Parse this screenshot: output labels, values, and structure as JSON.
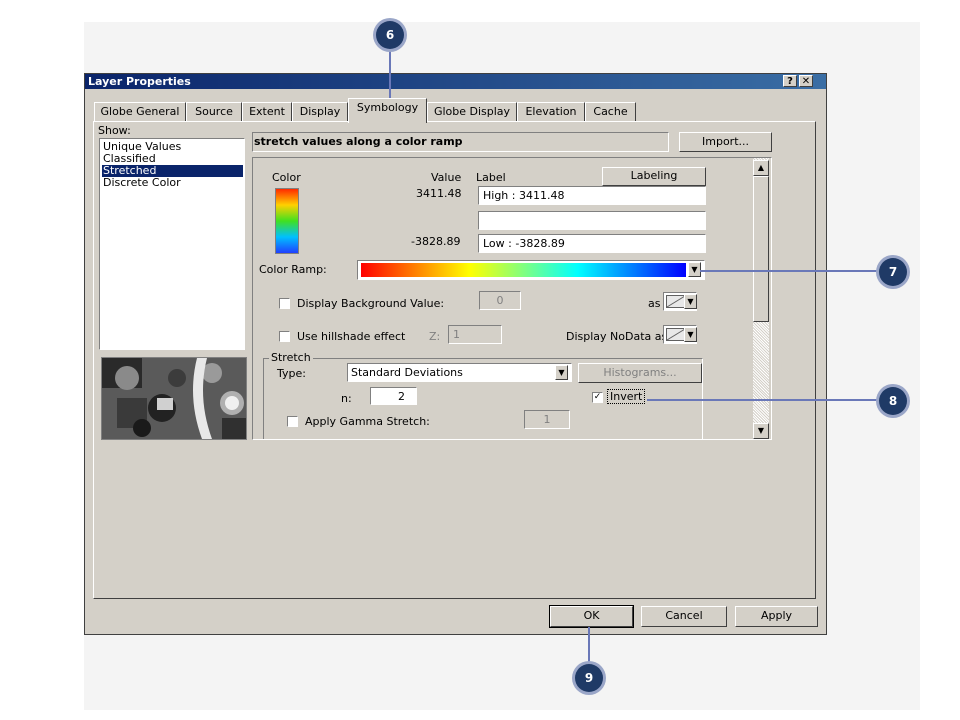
{
  "window": {
    "title": "Layer Properties",
    "help_btn": "?",
    "close_btn": "✕"
  },
  "tabs": [
    "Globe General",
    "Source",
    "Extent",
    "Display",
    "Symbology",
    "Globe Display",
    "Elevation",
    "Cache"
  ],
  "active_tab": "Symbology",
  "show": {
    "label": "Show:",
    "items": [
      "Unique Values",
      "Classified",
      "Stretched",
      "Discrete Color"
    ],
    "selected": "Stretched"
  },
  "header": {
    "description": "stretch values along a color ramp",
    "import_button": "Import..."
  },
  "legend": {
    "color_header": "Color",
    "value_header": "Value",
    "label_header": "Label",
    "labeling_button": "Labeling",
    "high_value": "3411.48",
    "high_label": "High : 3411.48",
    "mid_label": "",
    "low_value": "-3828.89",
    "low_label": "Low : -3828.89"
  },
  "color_ramp": {
    "label": "Color Ramp:"
  },
  "background": {
    "label": "Display Background Value:",
    "value": "0",
    "as_label": "as",
    "checked": false
  },
  "hillshade": {
    "label": "Use hillshade effect",
    "z_label": "Z:",
    "z_value": "1",
    "nodata_label": "Display NoData as",
    "checked": false
  },
  "stretch": {
    "group_label": "Stretch",
    "type_label": "Type:",
    "type_value": "Standard Deviations",
    "histograms_button": "Histograms...",
    "n_label": "n:",
    "n_value": "2",
    "invert_label": "Invert",
    "invert_checked": true,
    "gamma_label": "Apply Gamma Stretch:",
    "gamma_value": "1",
    "gamma_checked": false
  },
  "footer": {
    "ok": "OK",
    "cancel": "Cancel",
    "apply": "Apply"
  },
  "callouts": [
    "6",
    "7",
    "8",
    "9"
  ],
  "colors": {
    "title_start": "#0a246a",
    "title_end": "#3a6ea5",
    "dialog_face": "#d4d0c8",
    "callout": "#1f3a66",
    "callout_line": "#6a78b8"
  },
  "check_glyph": "✓"
}
